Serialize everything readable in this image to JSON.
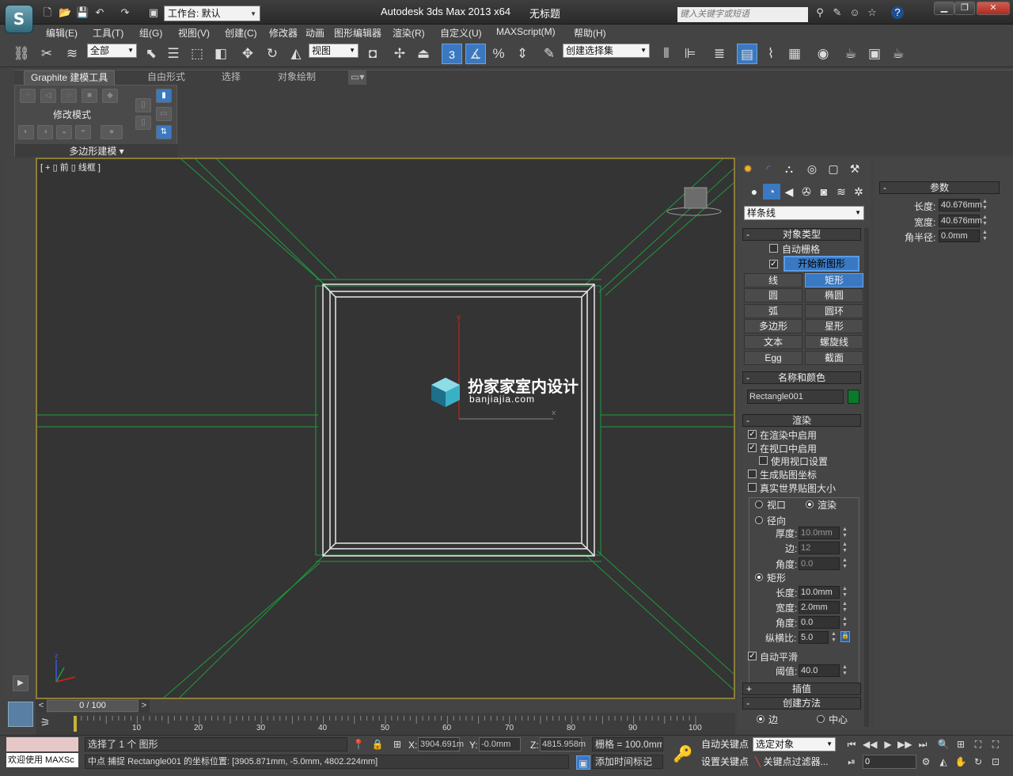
{
  "app": {
    "product": "Autodesk 3ds Max  2013 x64",
    "doc_title": "无标题",
    "workspace": "工作台: 默认",
    "search_placeholder": "键入关键字或短语"
  },
  "menu": [
    "编辑(E)",
    "工具(T)",
    "组(G)",
    "视图(V)",
    "创建(C)",
    "修改器",
    "动画",
    "图形编辑器",
    "渲染(R)",
    "自定义(U)",
    "MAXScript(M)",
    "帮助(H)"
  ],
  "toolbar": {
    "selection_filter": "全部",
    "ref_coord": "视图",
    "snap_number": "3",
    "percent_snap": "%",
    "named_selection": "创建选择集"
  },
  "ribbon": {
    "tabs": [
      "Graphite 建模工具",
      "自由形式",
      "选择",
      "对象绘制"
    ],
    "panel_label": "修改模式",
    "panel_footer": "多边形建模"
  },
  "viewport": {
    "label": "[ + ▯ 前 ▯ 线框 ]",
    "watermark_title": "扮家家室内设计",
    "watermark_url": "banjiajia.com",
    "axis_x": "x",
    "axis_y": "y",
    "axis_z": "z"
  },
  "command_panel": {
    "category": "样条线",
    "object_type_header": "对象类型",
    "auto_grid": "自动栅格",
    "start_new_shape": "开始新图形",
    "shape_buttons": [
      [
        "线",
        "矩形"
      ],
      [
        "圆",
        "椭圆"
      ],
      [
        "弧",
        "圆环"
      ],
      [
        "多边形",
        "星形"
      ],
      [
        "文本",
        "螺旋线"
      ],
      [
        "Egg",
        "截面"
      ]
    ],
    "name_color_header": "名称和颜色",
    "object_name": "Rectangle001",
    "object_color": "#0a7a2a",
    "render_header": "渲染",
    "enable_in_render": "在渲染中启用",
    "enable_in_viewport": "在视口中启用",
    "use_viewport_settings": "使用视口设置",
    "gen_mapping": "生成贴图坐标",
    "real_world_map": "真实世界贴图大小",
    "viewport_radio": "视口",
    "render_radio": "渲染",
    "radial": "径向",
    "thickness_label": "厚度:",
    "thickness": "10.0mm",
    "sides_label": "边:",
    "sides": "12",
    "angle_label": "角度:",
    "angle_radial": "0.0",
    "rectangular": "矩形",
    "length_label": "长度:",
    "rect_length": "10.0mm",
    "width_label": "宽度:",
    "rect_width": "2.0mm",
    "angle_rect": "0.0",
    "aspect_label": "纵横比:",
    "aspect": "5.0",
    "auto_smooth": "自动平滑",
    "threshold_label": "阈值:",
    "threshold": "40.0",
    "interp_header": "插值",
    "creation_header": "创建方法",
    "edge": "边",
    "center": "中心"
  },
  "parameters": {
    "header": "参数",
    "length_label": "长度:",
    "length": "40.676mm",
    "width_label": "宽度:",
    "width": "40.676mm",
    "corner_label": "角半径:",
    "corner": "0.0mm"
  },
  "timeline": {
    "frame": "0 / 100",
    "ticks": [
      "10",
      "20",
      "30",
      "40",
      "50",
      "60",
      "70",
      "80",
      "90",
      "100"
    ]
  },
  "status": {
    "maxscript": "欢迎使用 MAXSc",
    "selected": "选择了 1 个 图形",
    "prompt": "中点 捕捉 Rectangle001 的坐标位置:  [3905.871mm, -5.0mm, 4802.224mm]",
    "x_label": "X:",
    "x": "3904.691m",
    "y_label": "Y:",
    "y": "-0.0mm",
    "z_label": "Z:",
    "z": "4815.958m",
    "grid": "栅格 = 100.0mm",
    "auto_key": "自动关键点",
    "set_key": "设置关键点",
    "key_mode": "选定对象",
    "key_filters": "关键点过滤器...",
    "add_time_tag": "添加时间标记",
    "current_frame": "0"
  }
}
